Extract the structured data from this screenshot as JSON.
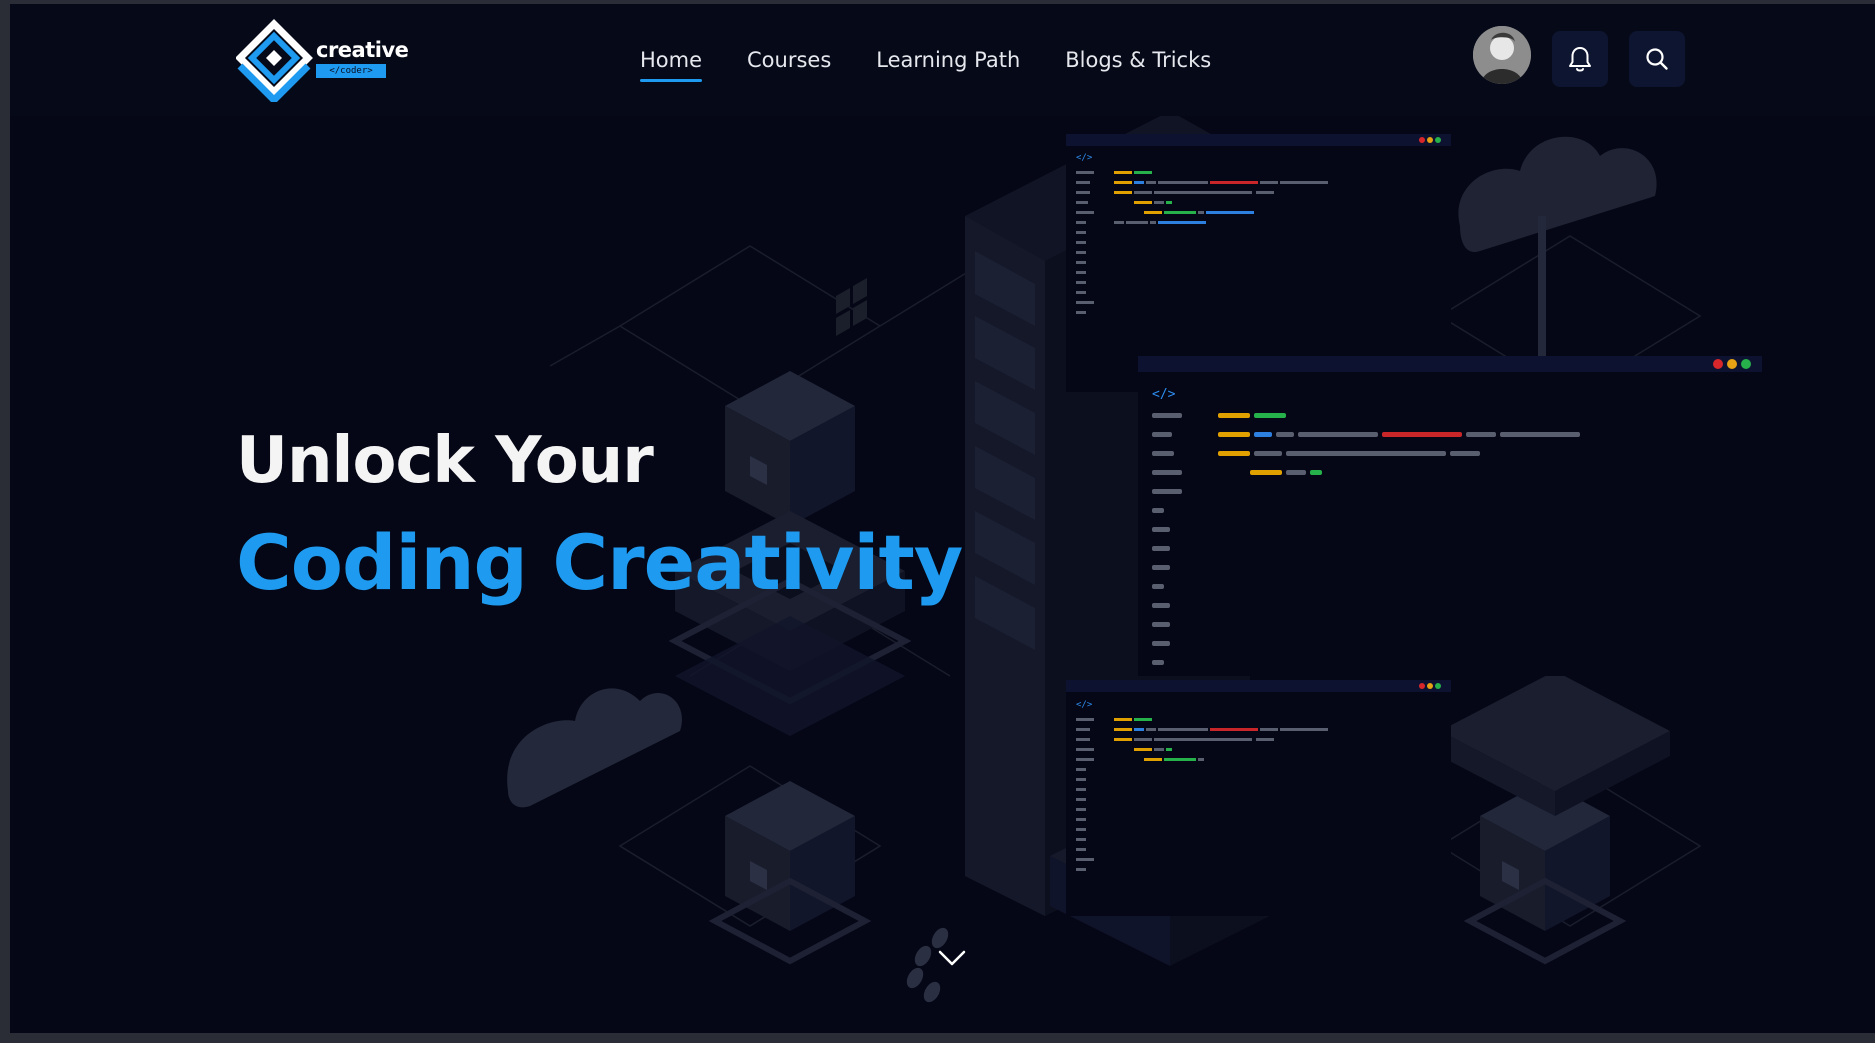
{
  "brand": {
    "name": "creative",
    "tagline": "</coder>",
    "accent_color": "#1e9bf0"
  },
  "nav": {
    "items": [
      {
        "label": "Home",
        "active": true
      },
      {
        "label": "Courses",
        "active": false
      },
      {
        "label": "Learning Path",
        "active": false
      },
      {
        "label": "Blogs & Tricks",
        "active": false
      }
    ]
  },
  "header_actions": {
    "avatar": "user-avatar",
    "notifications_icon": "bell-icon",
    "search_icon": "search-icon"
  },
  "hero": {
    "line1": "Unlock Your",
    "line2": "Coding Creativity",
    "scroll_icon": "chevron-down-icon"
  },
  "code_windows": {
    "tag_text": "</>"
  }
}
